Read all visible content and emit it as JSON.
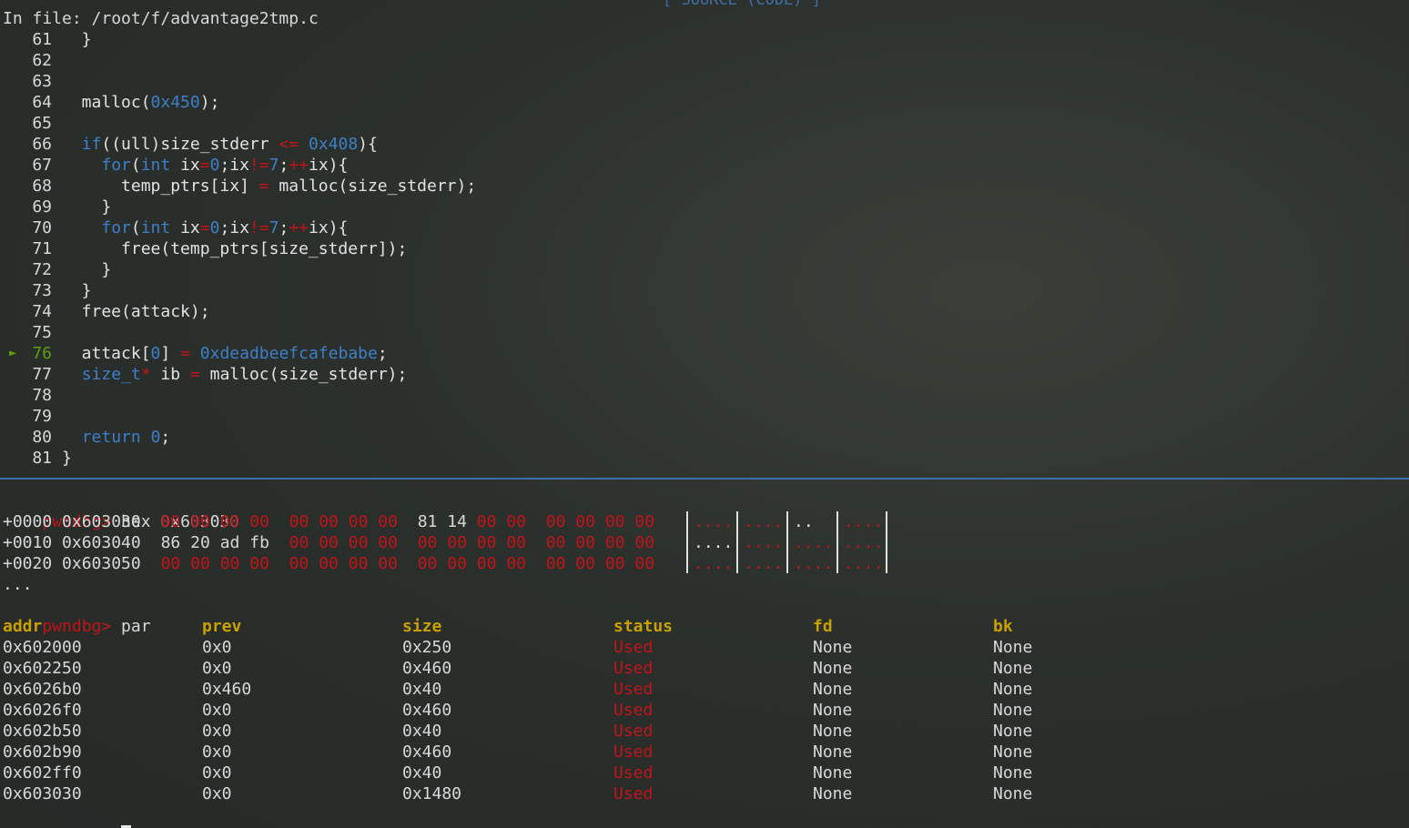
{
  "source_title": "[ SOURCE (CODE) ]",
  "file_header": "In file: /root/f/advantage2tmp.c",
  "current_line_marker": "►",
  "source_lines": [
    {
      "n": "61",
      "tokens": [
        [
          "txt",
          "  }"
        ]
      ]
    },
    {
      "n": "62",
      "tokens": []
    },
    {
      "n": "63",
      "tokens": []
    },
    {
      "n": "64",
      "tokens": [
        [
          "txt",
          "  malloc("
        ],
        [
          "num",
          "0x450"
        ],
        [
          "txt",
          ");"
        ]
      ]
    },
    {
      "n": "65",
      "tokens": []
    },
    {
      "n": "66",
      "tokens": [
        [
          "txt",
          "  "
        ],
        [
          "kw",
          "if"
        ],
        [
          "txt",
          "((ull)size_stderr "
        ],
        [
          "op",
          "<="
        ],
        [
          "txt",
          " "
        ],
        [
          "num",
          "0x408"
        ],
        [
          "txt",
          "){"
        ]
      ]
    },
    {
      "n": "67",
      "tokens": [
        [
          "txt",
          "    "
        ],
        [
          "kw",
          "for"
        ],
        [
          "txt",
          "("
        ],
        [
          "kw",
          "int"
        ],
        [
          "txt",
          " ix"
        ],
        [
          "op",
          "="
        ],
        [
          "num",
          "0"
        ],
        [
          "txt",
          ";ix"
        ],
        [
          "op",
          "!="
        ],
        [
          "num",
          "7"
        ],
        [
          "txt",
          ";"
        ],
        [
          "op",
          "++"
        ],
        [
          "txt",
          "ix){"
        ]
      ]
    },
    {
      "n": "68",
      "tokens": [
        [
          "txt",
          "      temp_ptrs[ix] "
        ],
        [
          "op",
          "="
        ],
        [
          "txt",
          " malloc(size_stderr);"
        ]
      ]
    },
    {
      "n": "69",
      "tokens": [
        [
          "txt",
          "    }"
        ]
      ]
    },
    {
      "n": "70",
      "tokens": [
        [
          "txt",
          "    "
        ],
        [
          "kw",
          "for"
        ],
        [
          "txt",
          "("
        ],
        [
          "kw",
          "int"
        ],
        [
          "txt",
          " ix"
        ],
        [
          "op",
          "="
        ],
        [
          "num",
          "0"
        ],
        [
          "txt",
          ";ix"
        ],
        [
          "op",
          "!="
        ],
        [
          "num",
          "7"
        ],
        [
          "txt",
          ";"
        ],
        [
          "op",
          "++"
        ],
        [
          "txt",
          "ix){"
        ]
      ]
    },
    {
      "n": "71",
      "tokens": [
        [
          "txt",
          "      free(temp_ptrs[size_stderr]);"
        ]
      ]
    },
    {
      "n": "72",
      "tokens": [
        [
          "txt",
          "    }"
        ]
      ]
    },
    {
      "n": "73",
      "tokens": [
        [
          "txt",
          "  }"
        ]
      ]
    },
    {
      "n": "74",
      "tokens": [
        [
          "txt",
          "  free(attack);"
        ]
      ]
    },
    {
      "n": "75",
      "tokens": []
    },
    {
      "n": "76",
      "current": true,
      "tokens": [
        [
          "txt",
          "  attack["
        ],
        [
          "num",
          "0"
        ],
        [
          "txt",
          "] "
        ],
        [
          "op",
          "="
        ],
        [
          "txt",
          " "
        ],
        [
          "num",
          "0xdeadbeefcafebabe"
        ],
        [
          "txt",
          ";"
        ]
      ]
    },
    {
      "n": "77",
      "tokens": [
        [
          "txt",
          "  "
        ],
        [
          "kw",
          "size_t"
        ],
        [
          "op",
          "*"
        ],
        [
          "txt",
          " ib "
        ],
        [
          "op",
          "="
        ],
        [
          "txt",
          " malloc(size_stderr);"
        ]
      ]
    },
    {
      "n": "78",
      "tokens": []
    },
    {
      "n": "79",
      "tokens": []
    },
    {
      "n": "80",
      "tokens": [
        [
          "txt",
          "  "
        ],
        [
          "kw",
          "return"
        ],
        [
          "txt",
          " "
        ],
        [
          "num",
          "0"
        ],
        [
          "txt",
          ";"
        ]
      ]
    },
    {
      "n": "81",
      "tokens": [
        [
          "txt",
          "}"
        ]
      ]
    }
  ],
  "prompt": "pwndbg>",
  "hex_command": " hex 0x603030",
  "hex_rows": [
    {
      "offset": "+0000 0x603030",
      "bytes": [
        "00",
        "00",
        "00",
        "00",
        "00",
        "00",
        "00",
        "00",
        "81",
        "14",
        "00",
        "00",
        "00",
        "00",
        "00",
        "00"
      ],
      "ascii": [
        "....",
        "....",
        "..  ",
        "...."
      ]
    },
    {
      "offset": "+0010 0x603040",
      "bytes": [
        "86",
        "20",
        "ad",
        "fb",
        "00",
        "00",
        "00",
        "00",
        "00",
        "00",
        "00",
        "00",
        "00",
        "00",
        "00",
        "00"
      ],
      "ascii": [
        "....",
        "....",
        "....",
        "...."
      ]
    },
    {
      "offset": "+0020 0x603050",
      "bytes": [
        "00",
        "00",
        "00",
        "00",
        "00",
        "00",
        "00",
        "00",
        "00",
        "00",
        "00",
        "00",
        "00",
        "00",
        "00",
        "00"
      ],
      "ascii": [
        "....",
        "....",
        "....",
        "...."
      ]
    }
  ],
  "ellipsis": "...",
  "par_command": " par",
  "par_headers": [
    "addr",
    "prev",
    "size",
    "status",
    "fd",
    "bk"
  ],
  "par_rows": [
    [
      "0x602000",
      "0x0",
      "0x250",
      "Used",
      "None",
      "None"
    ],
    [
      "0x602250",
      "0x0",
      "0x460",
      "Used",
      "None",
      "None"
    ],
    [
      "0x6026b0",
      "0x460",
      "0x40",
      "Used",
      "None",
      "None"
    ],
    [
      "0x6026f0",
      "0x0",
      "0x460",
      "Used",
      "None",
      "None"
    ],
    [
      "0x602b50",
      "0x0",
      "0x40",
      "Used",
      "None",
      "None"
    ],
    [
      "0x602b90",
      "0x0",
      "0x460",
      "Used",
      "None",
      "None"
    ],
    [
      "0x602ff0",
      "0x0",
      "0x40",
      "Used",
      "None",
      "None"
    ],
    [
      "0x603030",
      "0x0",
      "0x1480",
      "Used",
      "None",
      "None"
    ]
  ],
  "colors": {
    "prompt": "#c0141a",
    "keyword": "#3d7fc8",
    "header": "#c8a000",
    "current_line": "#5fa010",
    "divider": "#3d6ea8"
  }
}
